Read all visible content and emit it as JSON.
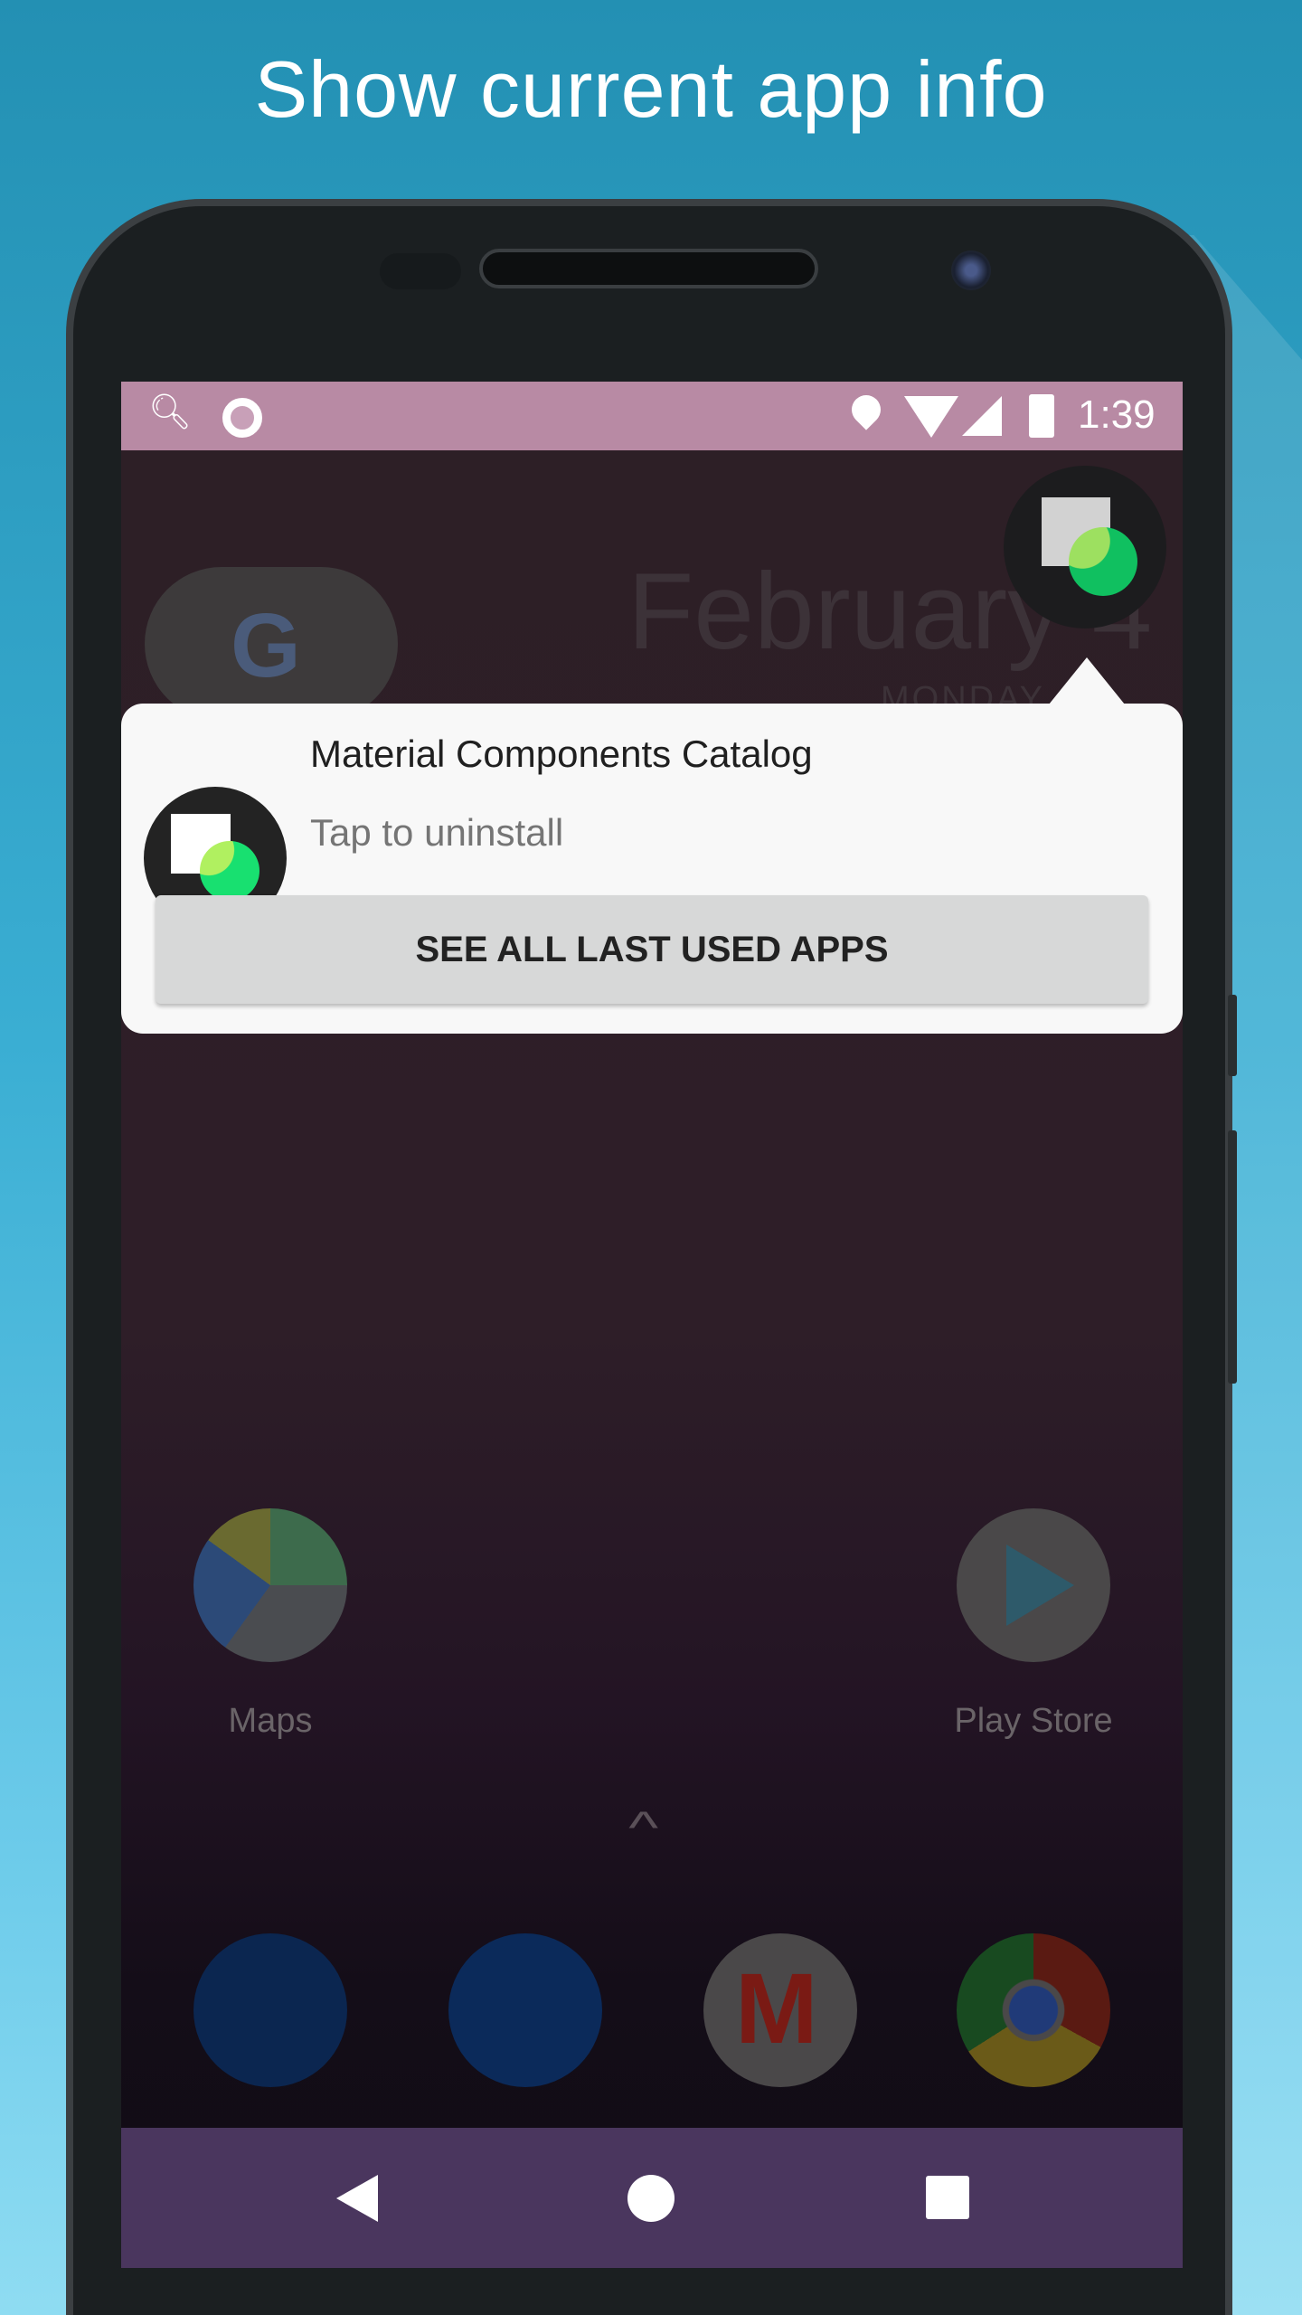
{
  "headline": "Show current app info",
  "status_bar": {
    "time": "1:39",
    "icons": [
      "accessibility-search-icon",
      "record-icon",
      "location-icon",
      "wifi-icon",
      "signal-icon",
      "battery-charging-icon"
    ]
  },
  "home": {
    "date": "February 4",
    "date_sub": "MONDAY",
    "apps": [
      {
        "label": "Maps",
        "icon": "maps-icon"
      },
      {
        "label": "Play Store",
        "icon": "play-store-icon"
      }
    ],
    "dock": [
      "phone-icon",
      "messages-icon",
      "gmail-icon",
      "chrome-icon"
    ]
  },
  "popup": {
    "app_name": "Material Components Catalog",
    "subtitle": "Tap to uninstall",
    "button": "SEE ALL LAST USED APPS"
  },
  "colors": {
    "status_bar": "#b88aa4",
    "nav_bar": "#4a365e",
    "app_green": "#10c060",
    "popup_bg": "#f8f8f8"
  }
}
